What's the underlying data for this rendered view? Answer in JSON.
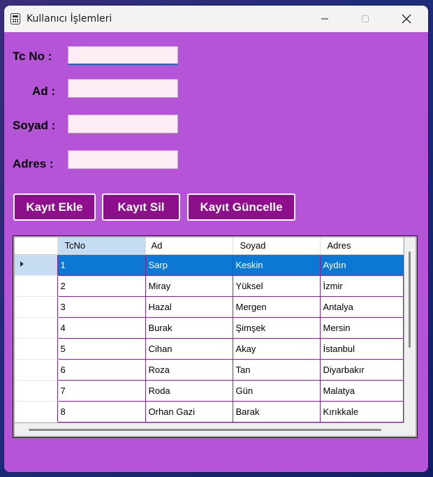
{
  "window": {
    "title": "Kullanıcı İşlemleri"
  },
  "form": {
    "tc_label": "Tc No :",
    "ad_label": "Ad :",
    "soyad_label": "Soyad :",
    "adres_label": "Adres :",
    "tc_value": "",
    "ad_value": "",
    "soyad_value": "",
    "adres_value": ""
  },
  "buttons": {
    "add": "Kayıt Ekle",
    "delete": "Kayıt Sil",
    "update": "Kayıt Güncelle"
  },
  "grid": {
    "columns": [
      "TcNo",
      "Ad",
      "Soyad",
      "Adres"
    ],
    "selected_row": 0,
    "rows": [
      [
        "1",
        "Sarp",
        "Keskin",
        "Aydın"
      ],
      [
        "2",
        "Miray",
        "Yüksel",
        "İzmir"
      ],
      [
        "3",
        "Hazal",
        "Mergen",
        "Antalya"
      ],
      [
        "4",
        "Burak",
        "Şimşek",
        "Mersin"
      ],
      [
        "5",
        "Cihan",
        "Akay",
        "İstanbul"
      ],
      [
        "6",
        "Roza",
        "Tan",
        "Diyarbakır"
      ],
      [
        "7",
        "Roda",
        "Gün",
        "Malatya"
      ],
      [
        "8",
        "Orhan Gazi",
        "Barak",
        "Kırıkkale"
      ]
    ]
  },
  "colors": {
    "background": "#b554d6",
    "button": "#8e0f8c",
    "selection": "#0d78d4",
    "field": "#fdeef6"
  }
}
